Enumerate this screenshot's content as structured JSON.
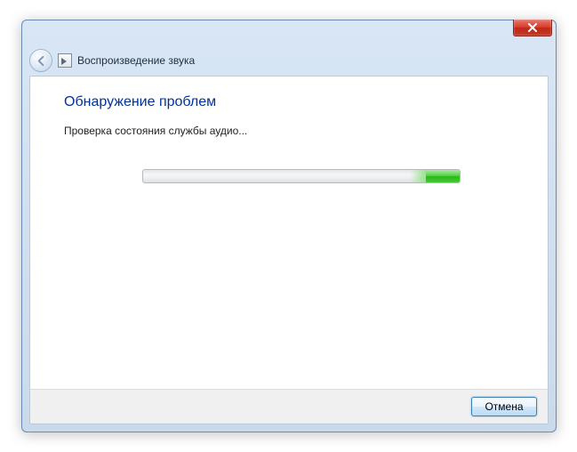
{
  "window": {
    "title": "Воспроизведение звука"
  },
  "content": {
    "heading": "Обнаружение проблем",
    "status": "Проверка состояния службы аудио..."
  },
  "footer": {
    "cancel": "Отмена"
  }
}
